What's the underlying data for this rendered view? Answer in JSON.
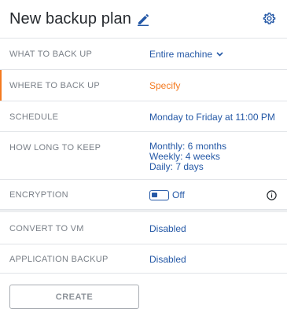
{
  "header": {
    "title": "New backup plan",
    "edit_icon": "pencil-icon",
    "settings_icon": "gear-icon"
  },
  "rows": {
    "what": {
      "label": "WHAT TO BACK UP",
      "value": "Entire machine"
    },
    "where": {
      "label": "WHERE TO BACK UP",
      "value": "Specify"
    },
    "schedule": {
      "label": "SCHEDULE",
      "value": "Monday to Friday at 11:00 PM"
    },
    "keep": {
      "label": "HOW LONG TO KEEP",
      "values": [
        "Monthly: 6 months",
        "Weekly: 4 weeks",
        "Daily: 7 days"
      ]
    },
    "encryption": {
      "label": "ENCRYPTION",
      "toggle_label": "Off",
      "enabled": false
    },
    "convert": {
      "label": "CONVERT TO VM",
      "value": "Disabled"
    },
    "app_backup": {
      "label": "APPLICATION BACKUP",
      "value": "Disabled"
    }
  },
  "actions": {
    "create_label": "CREATE"
  },
  "colors": {
    "link": "#2458a6",
    "warning": "#f47a20",
    "label": "#7a8088",
    "title": "#25292e"
  }
}
